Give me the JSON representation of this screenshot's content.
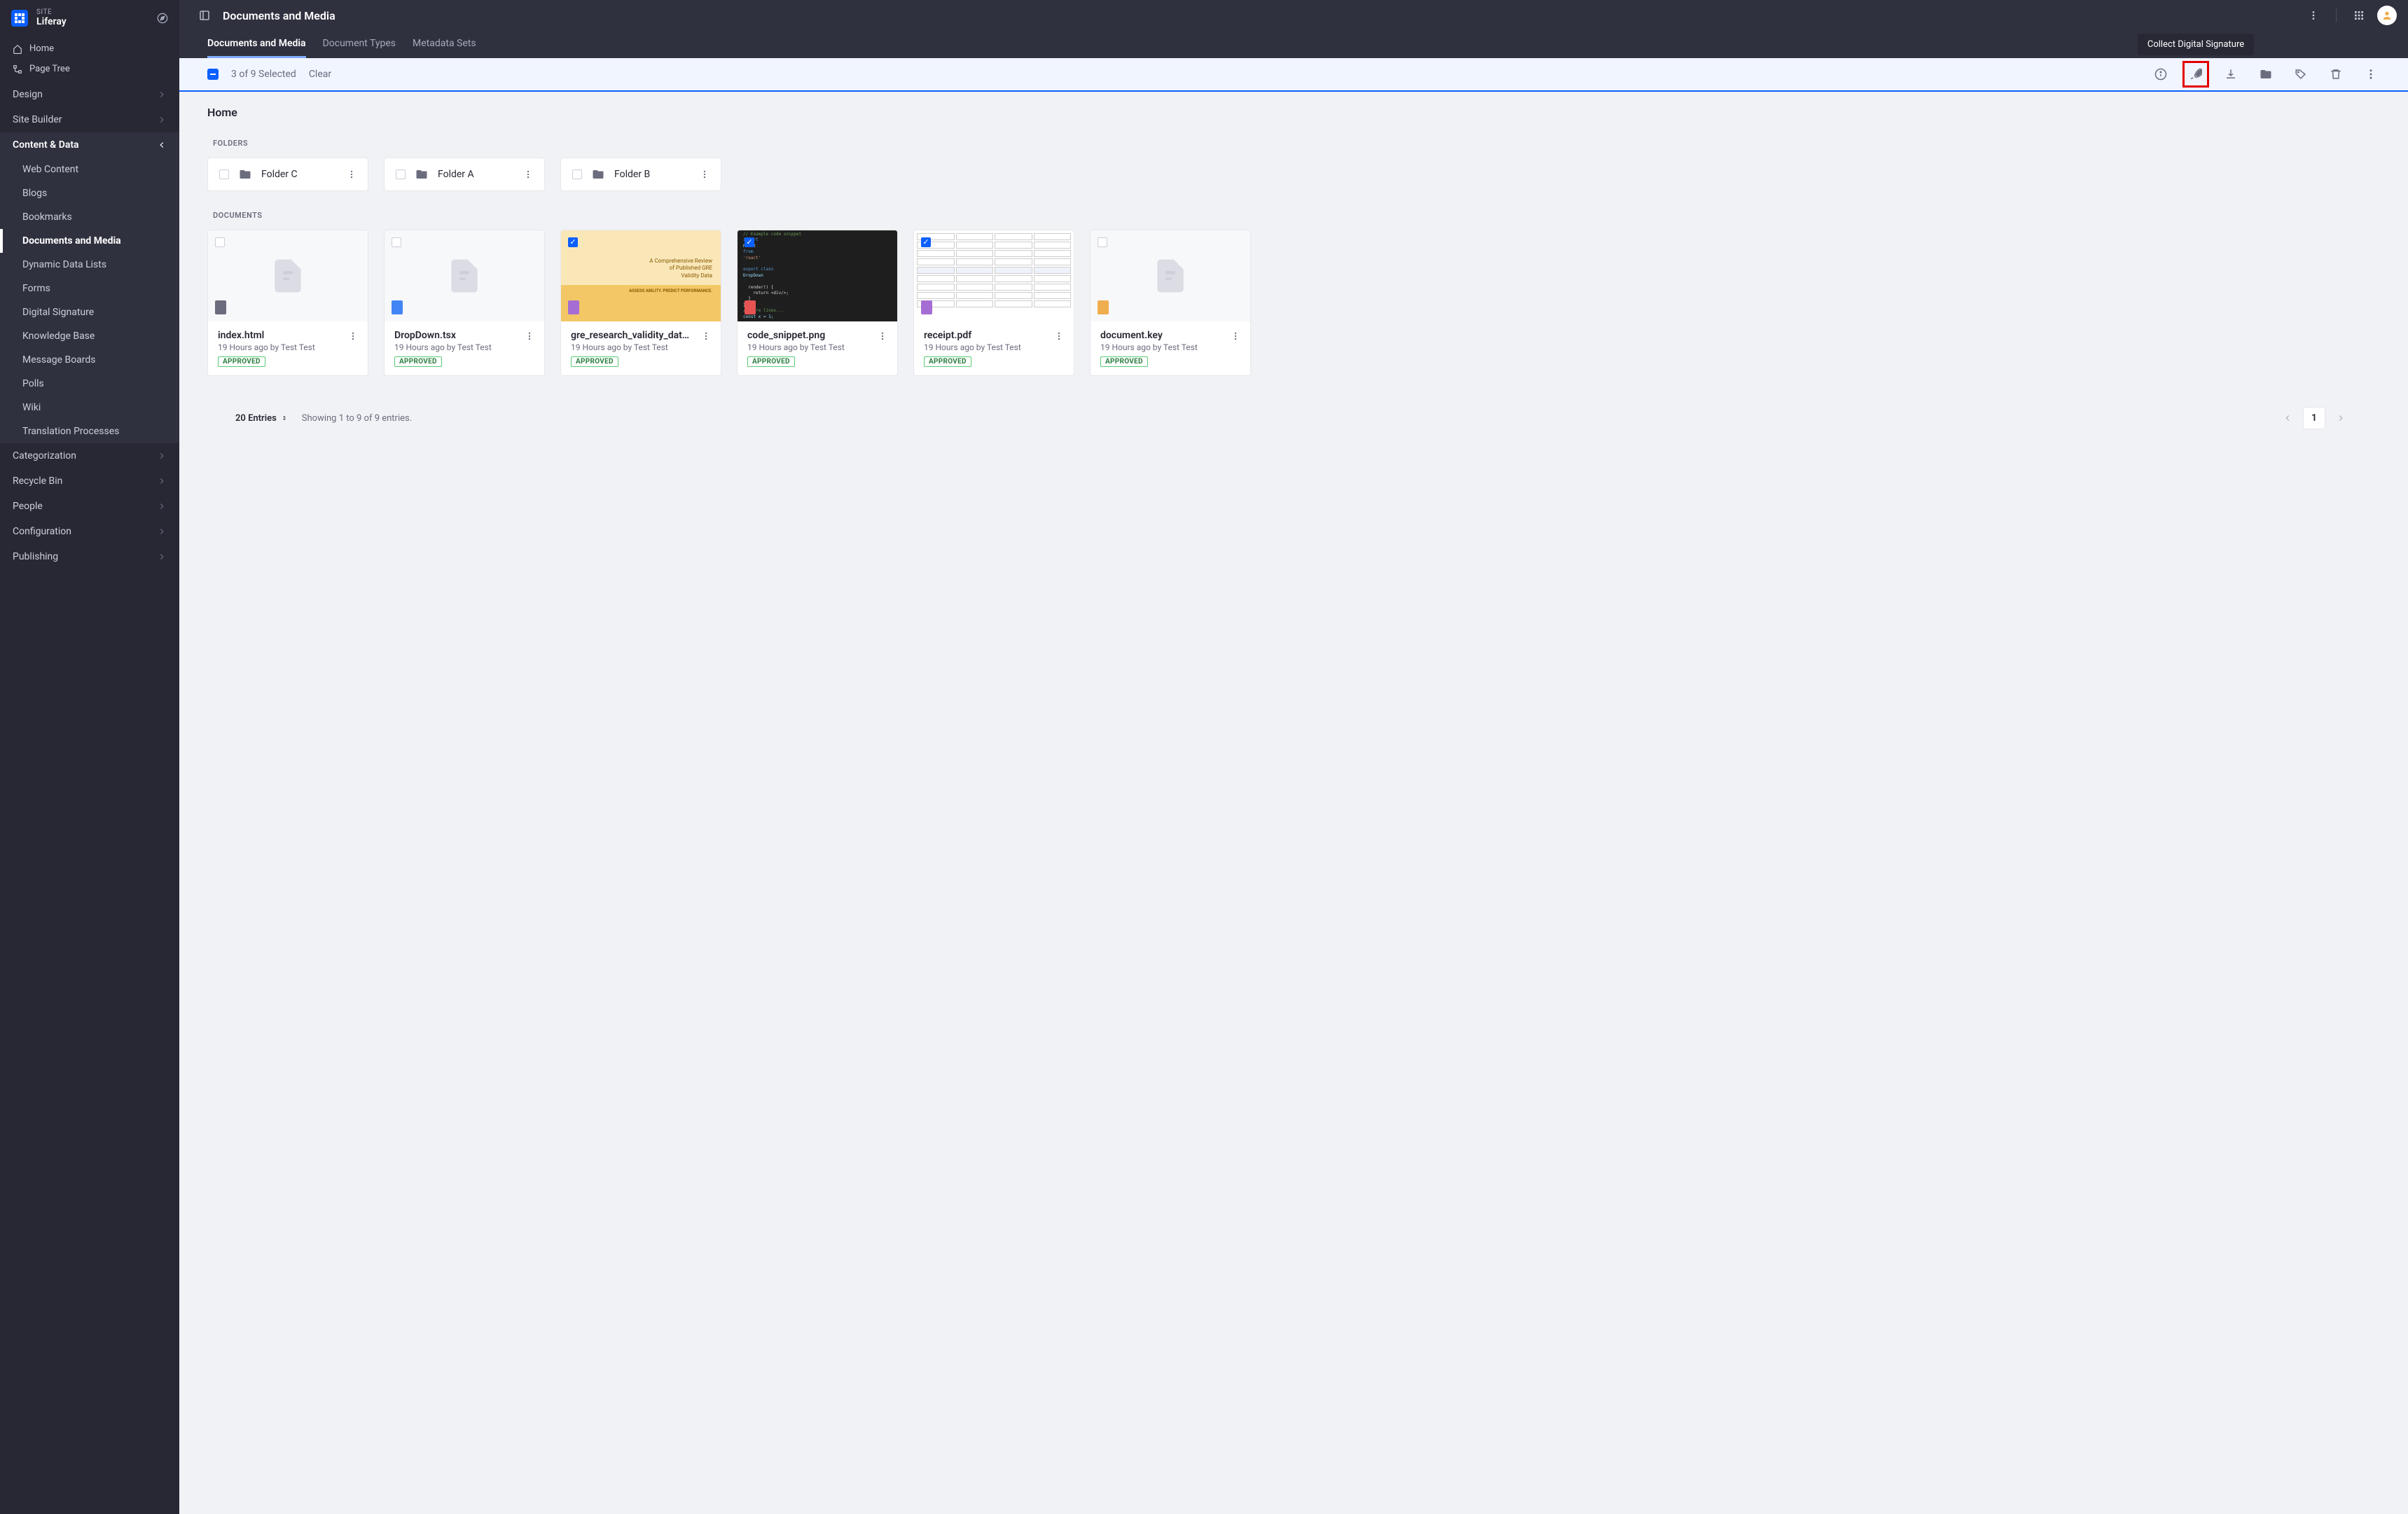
{
  "site": {
    "label_top": "SITE",
    "name": "Liferay"
  },
  "nav_flat": [
    {
      "label": "Home",
      "icon": "home"
    },
    {
      "label": "Page Tree",
      "icon": "tree"
    }
  ],
  "nav_groups": [
    {
      "label": "Design",
      "expanded": false
    },
    {
      "label": "Site Builder",
      "expanded": false
    },
    {
      "label": "Content & Data",
      "expanded": true,
      "items": [
        {
          "label": "Web Content"
        },
        {
          "label": "Blogs"
        },
        {
          "label": "Bookmarks"
        },
        {
          "label": "Documents and Media",
          "active": true
        },
        {
          "label": "Dynamic Data Lists"
        },
        {
          "label": "Forms"
        },
        {
          "label": "Digital Signature"
        },
        {
          "label": "Knowledge Base"
        },
        {
          "label": "Message Boards"
        },
        {
          "label": "Polls"
        },
        {
          "label": "Wiki"
        },
        {
          "label": "Translation Processes"
        }
      ]
    },
    {
      "label": "Categorization",
      "expanded": false
    },
    {
      "label": "Recycle Bin",
      "expanded": false
    },
    {
      "label": "People",
      "expanded": false
    },
    {
      "label": "Configuration",
      "expanded": false
    },
    {
      "label": "Publishing",
      "expanded": false
    }
  ],
  "topbar": {
    "title": "Documents and Media"
  },
  "tabs": [
    {
      "label": "Documents and Media",
      "active": true
    },
    {
      "label": "Document Types"
    },
    {
      "label": "Metadata Sets"
    }
  ],
  "selection": {
    "text": "3 of 9 Selected",
    "clear": "Clear",
    "tooltip": "Collect Digital Signature"
  },
  "breadcrumb": "Home",
  "sections": {
    "folders_label": "FOLDERS",
    "documents_label": "DOCUMENTS"
  },
  "folders": [
    {
      "name": "Folder C"
    },
    {
      "name": "Folder A"
    },
    {
      "name": "Folder B"
    }
  ],
  "documents": [
    {
      "name": "index.html",
      "meta": "19 Hours ago by Test Test",
      "status": "APPROVED",
      "checked": false,
      "thumb": "placeholder",
      "badge": "#6b6c7e"
    },
    {
      "name": "DropDown.tsx",
      "meta": "19 Hours ago by Test Test",
      "status": "APPROVED",
      "checked": false,
      "thumb": "placeholder",
      "badge": "#4285f4"
    },
    {
      "name": "gre_research_validity_data.pdf",
      "meta": "19 Hours ago by Test Test",
      "status": "APPROVED",
      "checked": true,
      "thumb": "yellow",
      "badge": "#a66dd4"
    },
    {
      "name": "code_snippet.png",
      "meta": "19 Hours ago by Test Test",
      "status": "APPROVED",
      "checked": true,
      "thumb": "code",
      "badge": "#e55353"
    },
    {
      "name": "receipt.pdf",
      "meta": "19 Hours ago by Test Test",
      "status": "APPROVED",
      "checked": true,
      "thumb": "form",
      "badge": "#a66dd4"
    },
    {
      "name": "document.key",
      "meta": "19 Hours ago by Test Test",
      "status": "APPROVED",
      "checked": false,
      "thumb": "placeholder",
      "badge": "#f0ad4e"
    }
  ],
  "footer": {
    "count": "20 Entries",
    "info": "Showing 1 to 9 of 9 entries.",
    "page": "1"
  }
}
